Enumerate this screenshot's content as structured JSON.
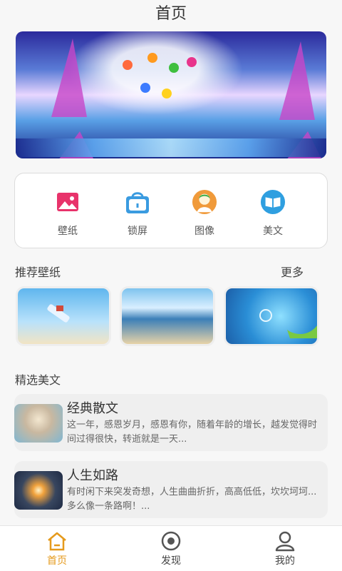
{
  "header": {
    "title": "首页"
  },
  "categories": [
    {
      "label": "壁纸",
      "icon": "picture-icon"
    },
    {
      "label": "锁屏",
      "icon": "lock-bag-icon"
    },
    {
      "label": "图像",
      "icon": "avatar-icon"
    },
    {
      "label": "美文",
      "icon": "book-icon"
    }
  ],
  "recommend": {
    "title": "推荐壁纸",
    "more": "更多"
  },
  "featured": {
    "title": "精选美文"
  },
  "articles": [
    {
      "title": "经典散文",
      "desc": "这一年，感恩岁月，感恩有你，随着年龄的增长，越发觉得时间过得很快，转逝就是一天..."
    },
    {
      "title": "人生如路",
      "desc": "有时闲下来突发奇想，人生曲曲折折，高高低低，坎坎坷坷...多么像一条路啊！..."
    }
  ],
  "tabs": [
    {
      "label": "首页",
      "icon": "home-icon",
      "active": true
    },
    {
      "label": "发现",
      "icon": "discover-icon",
      "active": false
    },
    {
      "label": "我的",
      "icon": "profile-icon",
      "active": false
    }
  ],
  "colors": {
    "accent": "#e59a1c",
    "text": "#333333",
    "background": "#f7f7f7"
  }
}
